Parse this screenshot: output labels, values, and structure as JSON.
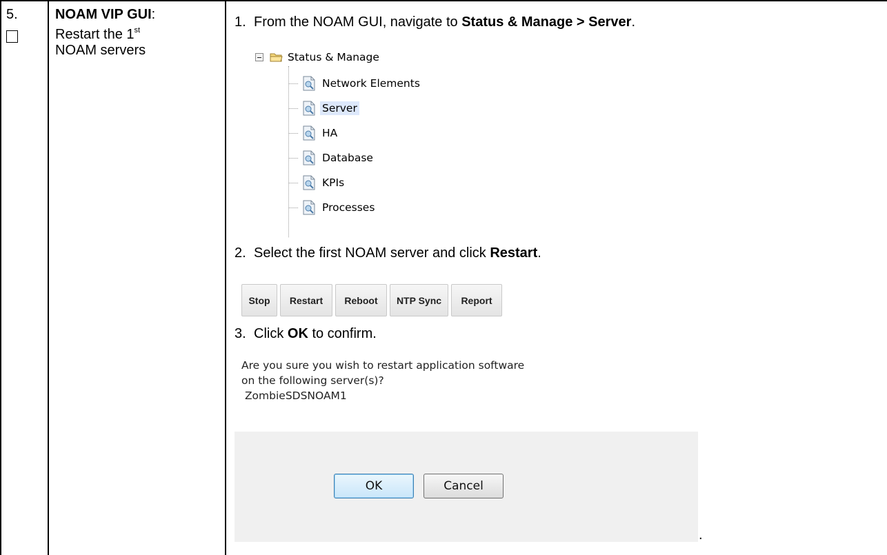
{
  "step": {
    "number": "5.",
    "title_bold": "NOAM VIP GUI",
    "title_colon": ":",
    "title_line2_pre": "Restart the 1",
    "title_sup": "st",
    "title_line3": "NOAM servers"
  },
  "instructions": [
    {
      "num": "1.",
      "pre": "From the NOAM GUI, navigate to ",
      "bold": "Status & Manage > Server",
      "post": "."
    },
    {
      "num": "2.",
      "pre": "Select the first NOAM server and click ",
      "bold": "Restart",
      "post": "."
    },
    {
      "num": "3.",
      "pre": "Click ",
      "bold": "OK",
      "post": " to confirm."
    }
  ],
  "tree": {
    "root": "Status & Manage",
    "items": [
      "Network Elements",
      "Server",
      "HA",
      "Database",
      "KPIs",
      "Processes"
    ],
    "selected": "Server"
  },
  "action_buttons": [
    "Stop",
    "Restart",
    "Reboot",
    "NTP Sync",
    "Report"
  ],
  "dialog": {
    "message_line1": "Are you sure you wish to restart application software",
    "message_line2": "on the following server(s)?",
    "server": "ZombieSDSNOAM1",
    "ok_label": "OK",
    "cancel_label": "Cancel"
  },
  "trailing": "."
}
